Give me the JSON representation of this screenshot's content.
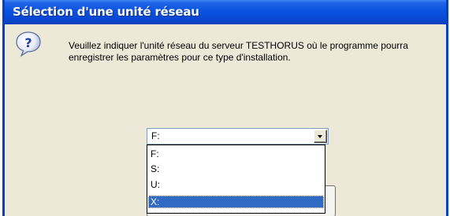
{
  "dialog": {
    "title": "Sélection d'une unité réseau",
    "message": "Veuillez indiquer l'unité réseau du serveur TESTHORUS où le programme pourra enregistrer les paramètres pour ce type d'installation.",
    "icon": "question-icon"
  },
  "drive_select": {
    "selected_value": "F:",
    "options": [
      "F:",
      "S:",
      "U:",
      "X:"
    ],
    "highlighted_option": "X:"
  },
  "colors": {
    "title_bar": "#0a53e0",
    "window_border": "#0b3fc2",
    "dialog_background": "#ece9d8",
    "selection_highlight": "#316ac5"
  }
}
